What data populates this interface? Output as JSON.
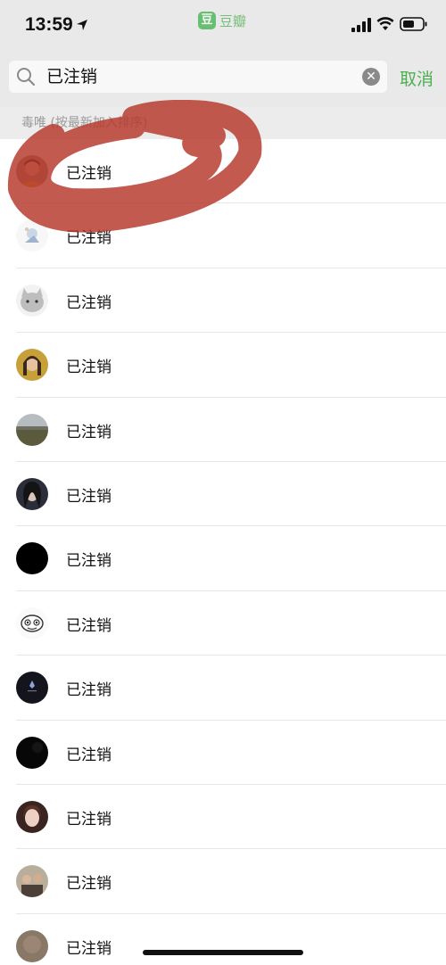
{
  "status_bar": {
    "time": "13:59",
    "app_name": "豆瓣",
    "app_logo_text": "豆",
    "accent_color": "#4caf50"
  },
  "search": {
    "query": "已注销",
    "cancel_label": "取消"
  },
  "section": {
    "header": "毒唯 (按最新加入排序)"
  },
  "results": [
    {
      "label": "已注销",
      "avatar": "photo-man"
    },
    {
      "label": "已注销",
      "avatar": "illustration-white"
    },
    {
      "label": "已注销",
      "avatar": "cat"
    },
    {
      "label": "已注销",
      "avatar": "photo-woman-warm"
    },
    {
      "label": "已注销",
      "avatar": "landscape"
    },
    {
      "label": "已注销",
      "avatar": "photo-woman-dark"
    },
    {
      "label": "已注销",
      "avatar": "black"
    },
    {
      "label": "已注销",
      "avatar": "cartoon-sketch"
    },
    {
      "label": "已注销",
      "avatar": "dark-logo"
    },
    {
      "label": "已注销",
      "avatar": "black-texture"
    },
    {
      "label": "已注销",
      "avatar": "photo-woman-pale"
    },
    {
      "label": "已注销",
      "avatar": "photo-group"
    },
    {
      "label": "已注销",
      "avatar": "brown-blur"
    }
  ]
}
